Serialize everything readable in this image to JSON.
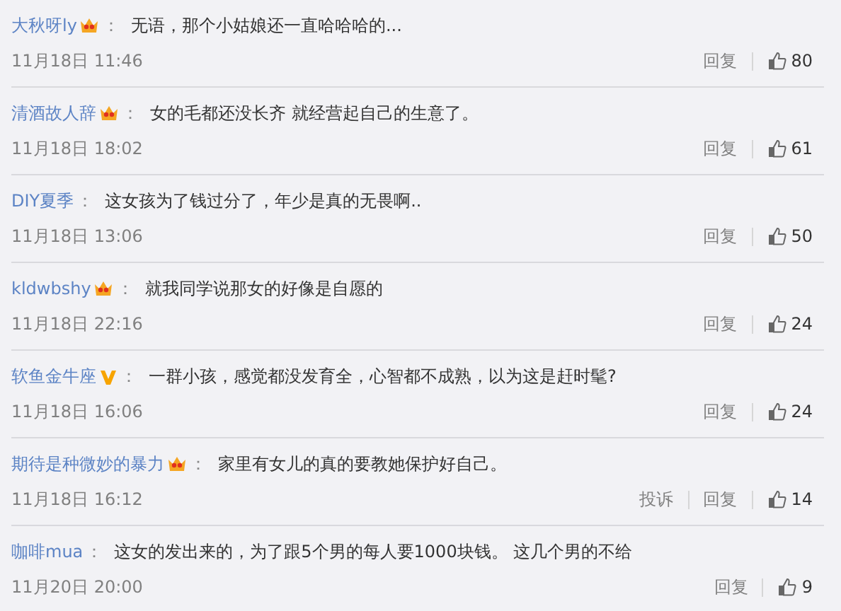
{
  "comments": [
    {
      "user": "大秋呀ly",
      "kind": "crown",
      "separator": "：",
      "text": "无语，那个小姑娘还一直哈哈哈的...",
      "time": "11月18日 11:46",
      "actions": [
        "回复"
      ],
      "likes": "80"
    },
    {
      "user": "清酒故人辞",
      "kind": "crown",
      "separator": "：",
      "text": "女的毛都还没长齐 就经营起自己的生意了。",
      "time": "11月18日 18:02",
      "actions": [
        "回复"
      ],
      "likes": "61"
    },
    {
      "user": "DIY夏季",
      "kind": "plain",
      "separator": "：",
      "text": "这女孩为了钱过分了，年少是真的无畏啊..",
      "time": "11月18日 13:06",
      "actions": [
        "回复"
      ],
      "likes": "50"
    },
    {
      "user": "kldwbshy",
      "kind": "crown",
      "separator": "：",
      "text": "就我同学说那女的好像是自愿的",
      "time": "11月18日 22:16",
      "actions": [
        "回复"
      ],
      "likes": "24"
    },
    {
      "user": "软鱼金牛座",
      "kind": "verified",
      "separator": "：",
      "text": "一群小孩，感觉都没发育全，心智都不成熟，以为这是赶时髦?",
      "time": "11月18日 16:06",
      "actions": [
        "回复"
      ],
      "likes": "24"
    },
    {
      "user": "期待是种微妙的暴力",
      "kind": "crown",
      "separator": "：",
      "text": "家里有女儿的真的要教她保护好自己。",
      "time": "11月18日 16:12",
      "actions": [
        "投诉",
        "回复"
      ],
      "likes": "14"
    },
    {
      "user": "咖啡mua",
      "kind": "plain",
      "separator": "：",
      "text": "这女的发出来的，为了跟5个男的每人要1000块钱。 这几个男的不给",
      "time": "11月20日 20:00",
      "actions": [
        "回复"
      ],
      "likes": "9"
    }
  ]
}
